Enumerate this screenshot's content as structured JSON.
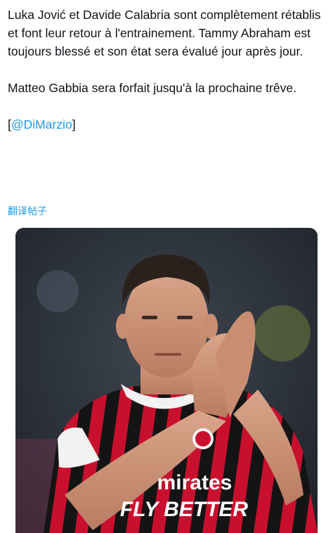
{
  "tweet": {
    "paragraph1": "Luka Jović et Davide Calabria sont complètement rétablis et font leur retour à l'entrainement. Tammy Abraham est toujours blessé et son état sera évalué jour après jour.",
    "paragraph2": "Matteo Gabbia sera forfait jusqu'à la prochaine trêve.",
    "mention_open": "[",
    "mention": "@DiMarzio",
    "mention_close": "]",
    "translate_link": "翻译帖子"
  },
  "media": {
    "image_description": "Football player in red and black striped AC Milan jersey applauding",
    "jersey_text_line1": "mirates",
    "jersey_text_line2": "FLY BETTER"
  },
  "colors": {
    "link": "#1d9bf0",
    "text": "#0f1419"
  }
}
